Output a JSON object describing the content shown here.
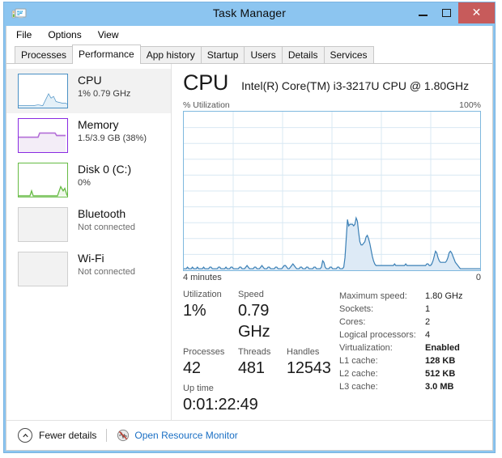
{
  "window": {
    "title": "Task Manager",
    "app_icon": "task-manager-icon",
    "controls": {
      "minimize": "minimize-icon",
      "maximize": "maximize-icon",
      "close": "✕"
    },
    "titlebar_color": "#8cc5f0",
    "close_button_color": "#c75b5b"
  },
  "menubar": {
    "items": [
      {
        "label": "File"
      },
      {
        "label": "Options"
      },
      {
        "label": "View"
      }
    ]
  },
  "tabs": {
    "active": "Performance",
    "items": [
      {
        "label": "Processes",
        "active": false
      },
      {
        "label": "Performance",
        "active": true
      },
      {
        "label": "App history",
        "active": false
      },
      {
        "label": "Startup",
        "active": false
      },
      {
        "label": "Users",
        "active": false
      },
      {
        "label": "Details",
        "active": false
      },
      {
        "label": "Services",
        "active": false
      }
    ]
  },
  "sidebar": {
    "items": [
      {
        "id": "cpu",
        "title": "CPU",
        "subtitle": "1% 0.79 GHz",
        "selected": true,
        "accent": "#4a90c4",
        "thumb": "cpu-mini-graph"
      },
      {
        "id": "memory",
        "title": "Memory",
        "subtitle": "1.5/3.9 GB (38%)",
        "selected": false,
        "accent": "#8a2be2",
        "thumb": "memory-mini-graph"
      },
      {
        "id": "disk0",
        "title": "Disk 0 (C:)",
        "subtitle": "0%",
        "selected": false,
        "accent": "#66bb44",
        "thumb": "disk-mini-graph"
      },
      {
        "id": "bluetooth",
        "title": "Bluetooth",
        "subtitle": "Not connected",
        "selected": false,
        "accent": "#cfcfcf",
        "thumb": "blank-mini-graph"
      },
      {
        "id": "wifi",
        "title": "Wi-Fi",
        "subtitle": "Not connected",
        "selected": false,
        "accent": "#cfcfcf",
        "thumb": "blank-mini-graph"
      }
    ]
  },
  "detail": {
    "title": "CPU",
    "subtitle": "Intel(R) Core(TM) i3-3217U CPU @ 1.80GHz",
    "chart_axis_label": "% Utilization",
    "chart_axis_max": "100%",
    "chart_time_left": "4 minutes",
    "chart_time_right": "0",
    "stats": [
      {
        "label": "Utilization",
        "value": "1%"
      },
      {
        "label": "Speed",
        "value": "0.79 GHz"
      },
      {
        "label": "Processes",
        "value": "42"
      },
      {
        "label": "Threads",
        "value": "481"
      },
      {
        "label": "Handles",
        "value": "12543"
      },
      {
        "label": "Up time",
        "value": "0:01:22:49"
      }
    ],
    "specs": [
      {
        "key": "Maximum speed:",
        "value": "1.80 GHz",
        "bold": false
      },
      {
        "key": "Sockets:",
        "value": "1",
        "bold": false
      },
      {
        "key": "Cores:",
        "value": "2",
        "bold": false
      },
      {
        "key": "Logical processors:",
        "value": "4",
        "bold": false
      },
      {
        "key": "Virtualization:",
        "value": "Enabled",
        "bold": true
      },
      {
        "key": "L1 cache:",
        "value": "128 KB",
        "bold": true
      },
      {
        "key": "L2 cache:",
        "value": "512 KB",
        "bold": true
      },
      {
        "key": "L3 cache:",
        "value": "3.0 MB",
        "bold": true
      }
    ]
  },
  "statusbar": {
    "chevron_icon": "chevron-up-icon",
    "fewer_details": "Fewer details",
    "resource_monitor_icon": "resource-monitor-icon",
    "resource_monitor_label": "Open Resource Monitor",
    "link_color": "#1a6fc4"
  },
  "chart_data": {
    "type": "area",
    "title": "CPU % Utilization",
    "xlabel": "",
    "ylabel": "% Utilization",
    "ylim": [
      0,
      100
    ],
    "xlim": [
      0,
      240
    ],
    "x_tick_labels": [
      "4 minutes",
      "0"
    ],
    "y_tick_labels": [
      "100%"
    ],
    "grid": true,
    "grid_rows": 10,
    "grid_cols": 6,
    "line_color": "#3a7fb5",
    "fill_color": "#ddeaf6",
    "series": [
      {
        "name": "CPU utilization",
        "values": [
          1,
          1,
          1,
          2,
          1,
          1,
          1,
          2,
          1,
          1,
          1,
          2,
          1,
          1,
          1,
          1,
          2,
          1,
          1,
          1,
          1,
          2,
          2,
          1,
          1,
          1,
          1,
          1,
          2,
          2,
          1,
          1,
          1,
          1,
          2,
          1,
          1,
          1,
          2,
          2,
          1,
          1,
          1,
          1,
          1,
          2,
          2,
          1,
          1,
          1,
          2,
          3,
          2,
          1,
          1,
          1,
          1,
          2,
          2,
          1,
          1,
          1,
          2,
          3,
          2,
          1,
          1,
          1,
          2,
          2,
          1,
          1,
          1,
          1,
          2,
          2,
          1,
          1,
          1,
          1,
          2,
          3,
          3,
          2,
          1,
          1,
          2,
          3,
          4,
          3,
          2,
          1,
          1,
          1,
          2,
          2,
          1,
          1,
          1,
          2,
          2,
          1,
          1,
          1,
          1,
          2,
          2,
          1,
          1,
          1,
          1,
          2,
          6,
          5,
          2,
          1,
          1,
          1,
          2,
          2,
          1,
          1,
          1,
          1,
          2,
          2,
          1,
          1,
          1,
          2,
          8,
          20,
          32,
          28,
          29,
          29,
          29,
          28,
          29,
          33,
          31,
          24,
          18,
          16,
          16,
          17,
          18,
          21,
          22,
          20,
          17,
          13,
          9,
          6,
          4,
          3,
          3,
          3,
          3,
          3,
          3,
          3,
          3,
          3,
          3,
          3,
          3,
          3,
          3,
          3,
          4,
          3,
          3,
          3,
          3,
          3,
          3,
          3,
          3,
          4,
          3,
          3,
          3,
          3,
          3,
          3,
          3,
          3,
          3,
          3,
          3,
          3,
          3,
          3,
          3,
          3,
          4,
          4,
          3,
          3,
          4,
          6,
          9,
          12,
          11,
          8,
          6,
          5,
          5,
          5,
          5,
          5,
          6,
          8,
          11,
          12,
          11,
          9,
          7,
          5,
          4,
          3,
          2,
          1,
          1,
          1,
          1,
          1,
          1,
          1,
          1,
          1,
          1,
          1,
          1,
          1,
          1,
          1,
          1,
          1
        ]
      }
    ]
  }
}
